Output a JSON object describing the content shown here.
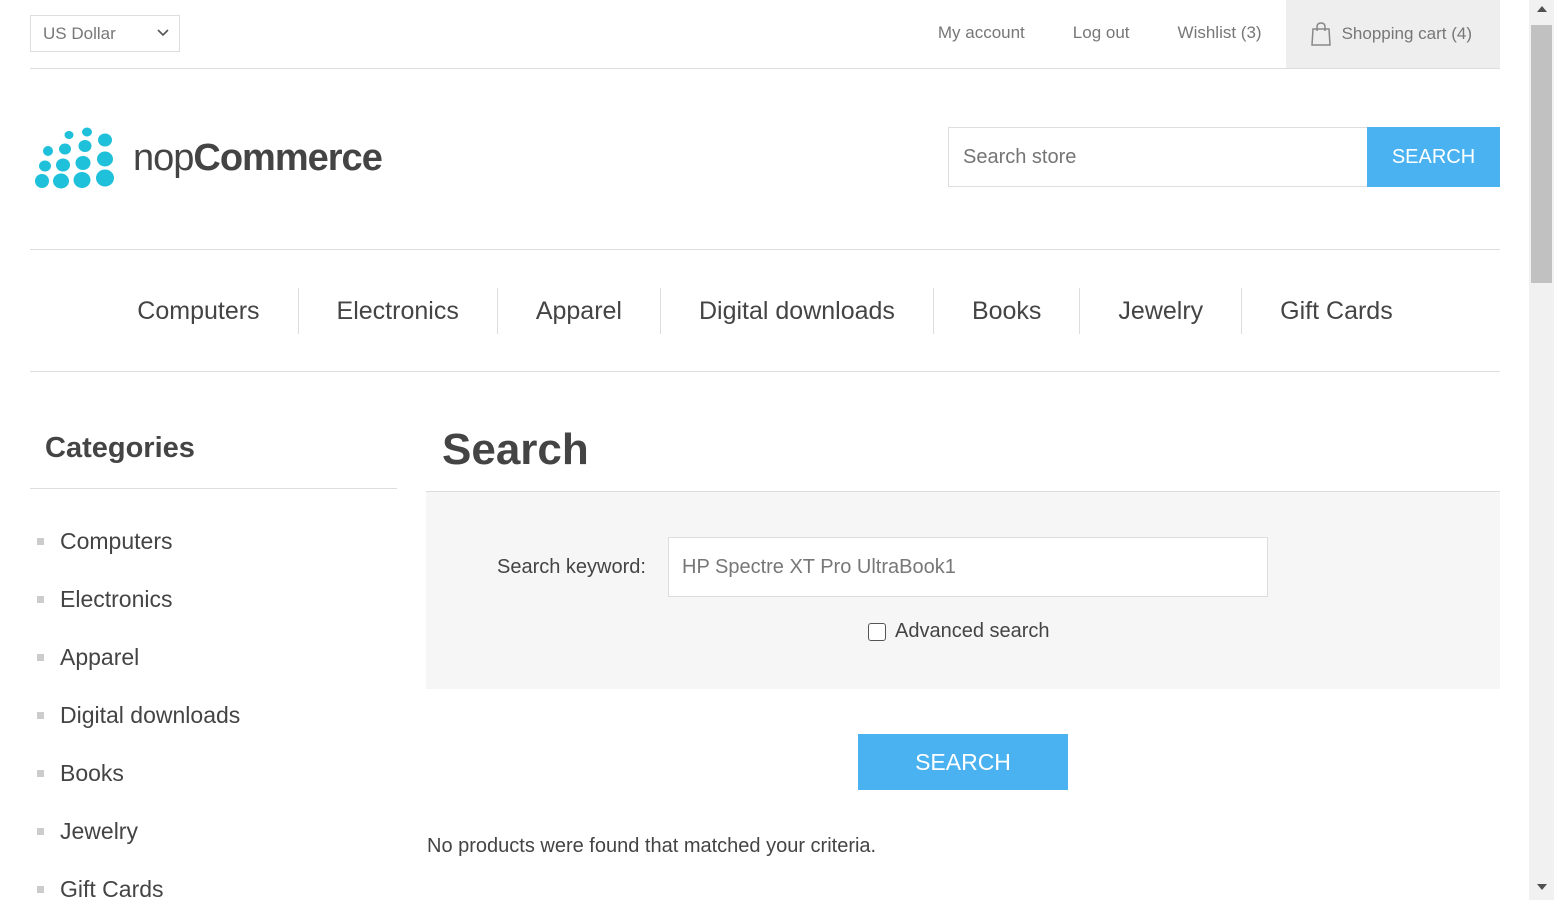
{
  "header": {
    "currency": "US Dollar",
    "links": {
      "my_account": "My account",
      "log_out": "Log out",
      "wishlist": "Wishlist (3)",
      "shopping_cart": "Shopping cart (4)"
    }
  },
  "logo": {
    "text_light": "nop",
    "text_bold": "Commerce",
    "color": "#1fc0da"
  },
  "store_search": {
    "placeholder": "Search store",
    "button": "SEARCH"
  },
  "top_menu": [
    "Computers",
    "Electronics",
    "Apparel",
    "Digital downloads",
    "Books",
    "Jewelry",
    "Gift Cards"
  ],
  "sidebar": {
    "title": "Categories",
    "items": [
      "Computers",
      "Electronics",
      "Apparel",
      "Digital downloads",
      "Books",
      "Jewelry",
      "Gift Cards"
    ]
  },
  "main": {
    "title": "Search",
    "keyword_label": "Search keyword:",
    "keyword_value": "HP Spectre XT Pro UltraBook1",
    "advanced_label": "Advanced search",
    "search_button": "SEARCH",
    "no_results": "No products were found that matched your criteria."
  },
  "colors": {
    "accent": "#4ab2f1"
  }
}
